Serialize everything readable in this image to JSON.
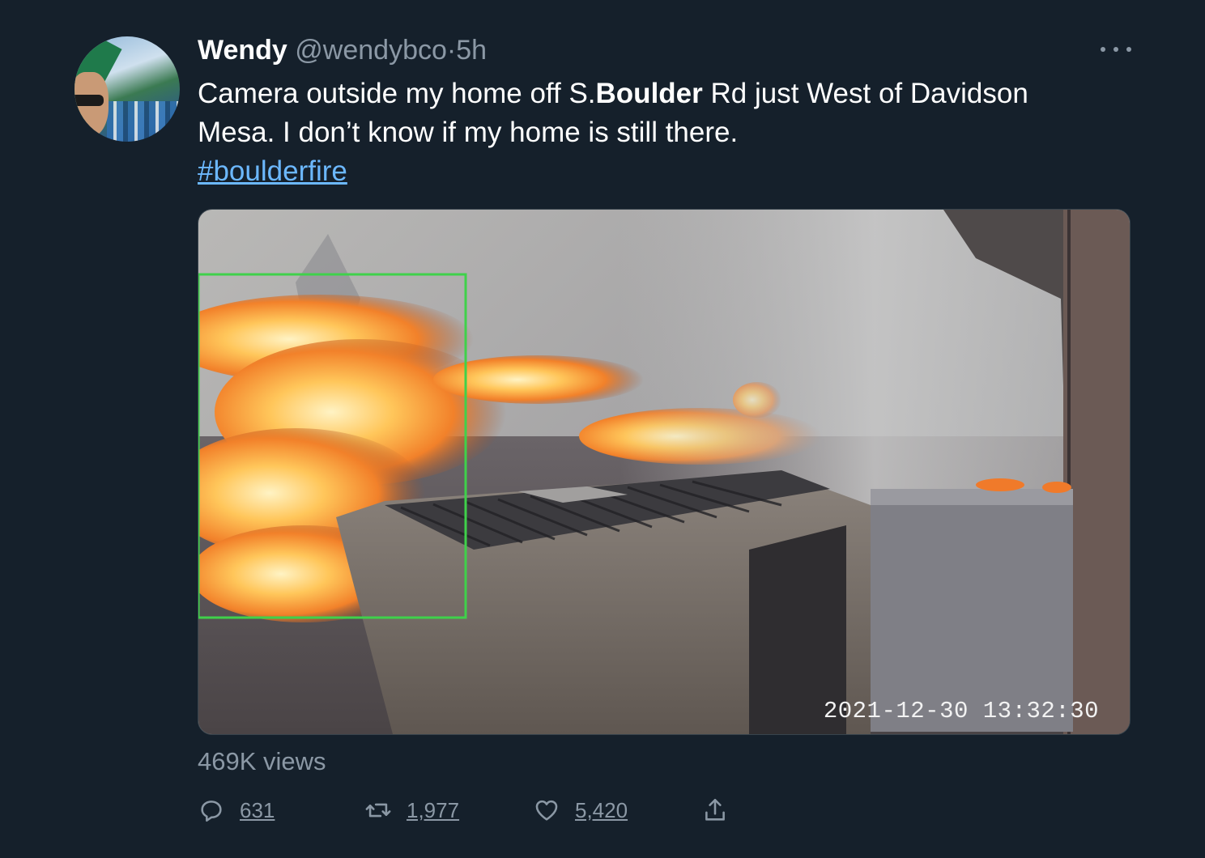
{
  "tweet": {
    "author_name": "Wendy",
    "author_handle": "@wendybco",
    "separator": "·",
    "time": "5h",
    "text_part1": "Camera outside my home off S.",
    "text_bold": "Boulder",
    "text_part2": " Rd just West of Davidson Mesa. I don’t know if my home is still there.",
    "hashtag": "#boulderfire",
    "media_timestamp": "2021-12-30 13:32:30",
    "views": "469K views"
  },
  "actions": {
    "reply_count": "631",
    "retweet_count": "1,977",
    "like_count": "5,420"
  },
  "colors": {
    "background": "#15202b",
    "secondary_text": "#8b98a5",
    "link": "#6cb8ff"
  },
  "icons": {
    "more": "more-horizontal-icon",
    "reply": "reply-icon",
    "retweet": "retweet-icon",
    "like": "heart-icon",
    "share": "share-icon"
  }
}
